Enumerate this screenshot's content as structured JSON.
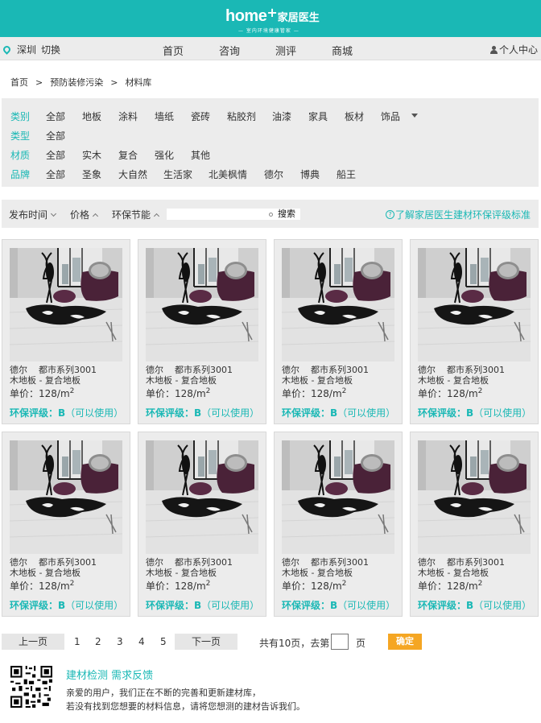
{
  "header": {
    "logo_home": "home",
    "logo_plus": "+",
    "logo_cn": "家居医生",
    "logo_slogan": "— 室内环境健康管家 —",
    "bg_color": "#1ab8b5"
  },
  "nav": {
    "city": "深圳",
    "switch": "切换",
    "items": [
      "首页",
      "咨询",
      "测评",
      "商城"
    ],
    "user_center": "个人中心"
  },
  "breadcrumb": [
    "首页",
    "预防装修污染",
    "材料库"
  ],
  "breadcrumb_sep": ">",
  "filters": {
    "category": {
      "label": "类别",
      "options": [
        "全部",
        "地板",
        "涂料",
        "墙纸",
        "瓷砖",
        "粘胶剂",
        "油漆",
        "家具",
        "板材",
        "饰品"
      ]
    },
    "type": {
      "label": "类型",
      "options": [
        "全部"
      ]
    },
    "material": {
      "label": "材质",
      "options": [
        "全部",
        "实木",
        "复合",
        "强化",
        "其他"
      ]
    },
    "brand": {
      "label": "品牌",
      "options": [
        "全部",
        "圣象",
        "大自然",
        "生活家",
        "北美枫情",
        "德尔",
        "博典",
        "船王"
      ]
    }
  },
  "sortbar": {
    "publish_time": "发布时间",
    "price": "价格",
    "eco": "环保节能",
    "search_value": "",
    "search_button": "搜索",
    "standard_link": "了解家居医生建材环保评级标准",
    "qicon": "?"
  },
  "products": [
    {
      "brand": "德尔",
      "series": "都市系列3001",
      "category": "木地板 - 复合地板",
      "price_label": "单价：",
      "price": "128/m",
      "price_sup": "2",
      "rating_label": "环保评级：",
      "rating": "B",
      "rating_note": "（可以使用）"
    },
    {
      "brand": "德尔",
      "series": "都市系列3001",
      "category": "木地板 - 复合地板",
      "price_label": "单价：",
      "price": "128/m",
      "price_sup": "2",
      "rating_label": "环保评级：",
      "rating": "B",
      "rating_note": "（可以使用）"
    },
    {
      "brand": "德尔",
      "series": "都市系列3001",
      "category": "木地板 - 复合地板",
      "price_label": "单价：",
      "price": "128/m",
      "price_sup": "2",
      "rating_label": "环保评级：",
      "rating": "B",
      "rating_note": "（可以使用）"
    },
    {
      "brand": "德尔",
      "series": "都市系列3001",
      "category": "木地板 - 复合地板",
      "price_label": "单价：",
      "price": "128/m",
      "price_sup": "2",
      "rating_label": "环保评级：",
      "rating": "B",
      "rating_note": "（可以使用）"
    },
    {
      "brand": "德尔",
      "series": "都市系列3001",
      "category": "木地板 - 复合地板",
      "price_label": "单价：",
      "price": "128/m",
      "price_sup": "2",
      "rating_label": "环保评级：",
      "rating": "B",
      "rating_note": "（可以使用）"
    },
    {
      "brand": "德尔",
      "series": "都市系列3001",
      "category": "木地板 - 复合地板",
      "price_label": "单价：",
      "price": "128/m",
      "price_sup": "2",
      "rating_label": "环保评级：",
      "rating": "B",
      "rating_note": "（可以使用）"
    },
    {
      "brand": "德尔",
      "series": "都市系列3001",
      "category": "木地板 - 复合地板",
      "price_label": "单价：",
      "price": "128/m",
      "price_sup": "2",
      "rating_label": "环保评级：",
      "rating": "B",
      "rating_note": "（可以使用）"
    },
    {
      "brand": "德尔",
      "series": "都市系列3001",
      "category": "木地板 - 复合地板",
      "price_label": "单价：",
      "price": "128/m",
      "price_sup": "2",
      "rating_label": "环保评级：",
      "rating": "B",
      "rating_note": "（可以使用）"
    }
  ],
  "pagination": {
    "prev": "上一页",
    "pages": [
      "1",
      "2",
      "3",
      "4",
      "5"
    ],
    "next": "下一页",
    "total": "共有10页，去第",
    "page_input": "",
    "unit": "页",
    "confirm": "确定"
  },
  "feedback": {
    "title": "建材检测 需求反馈",
    "line1": "亲爱的用户，我们正在不断的完善和更新建材库，",
    "line2": "若没有找到您想要的材料信息，请将您想测的建材告诉我们。"
  },
  "colors": {
    "accent": "#1ab8b5",
    "confirm": "#f5a623",
    "panel": "#ececec"
  }
}
